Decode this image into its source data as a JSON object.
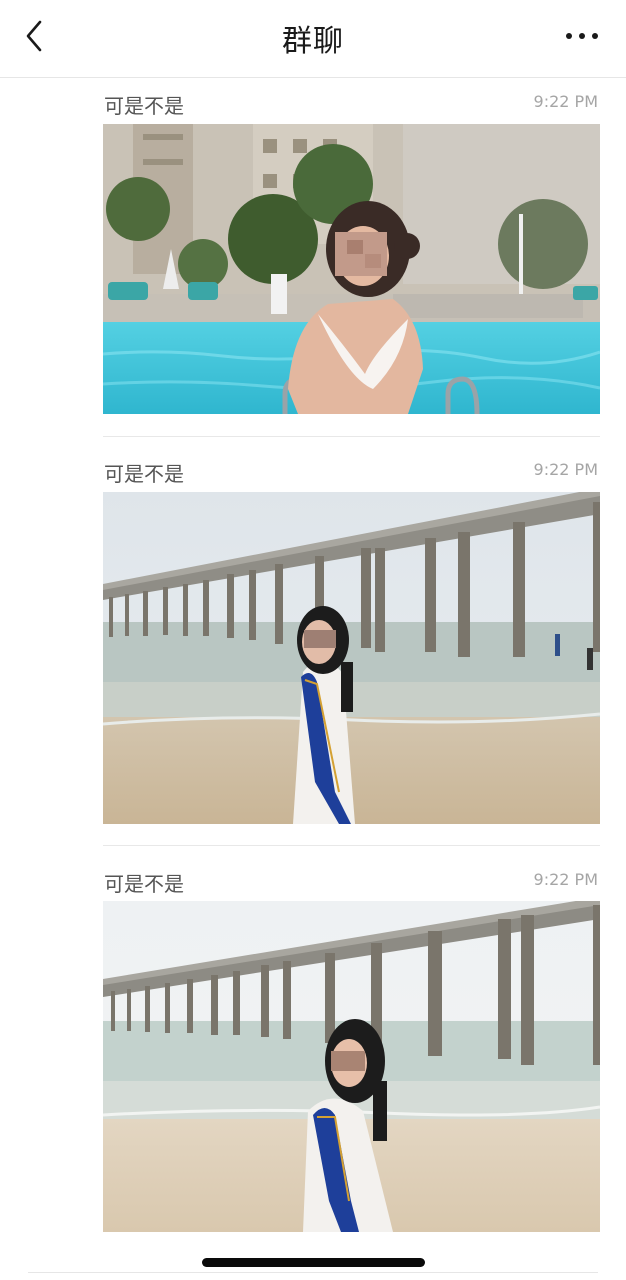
{
  "nav": {
    "title": "群聊",
    "back_icon": "chevron-left-icon",
    "more_icon": "ellipsis-icon"
  },
  "messages": [
    {
      "sender": "可是不是",
      "time": "9:22 PM",
      "photo": "pool-photo"
    },
    {
      "sender": "可是不是",
      "time": "9:22 PM",
      "photo": "pier-beach-photo"
    },
    {
      "sender": "可是不是",
      "time": "9:22 PM",
      "photo": "pier-beach-photo"
    }
  ],
  "colors": {
    "sender_text": "#555555",
    "time_text": "#a5a5a5",
    "divider": "#e8e8e8",
    "pool_water": "#3fc3d8",
    "sash_blue": "#1e3f9a"
  }
}
